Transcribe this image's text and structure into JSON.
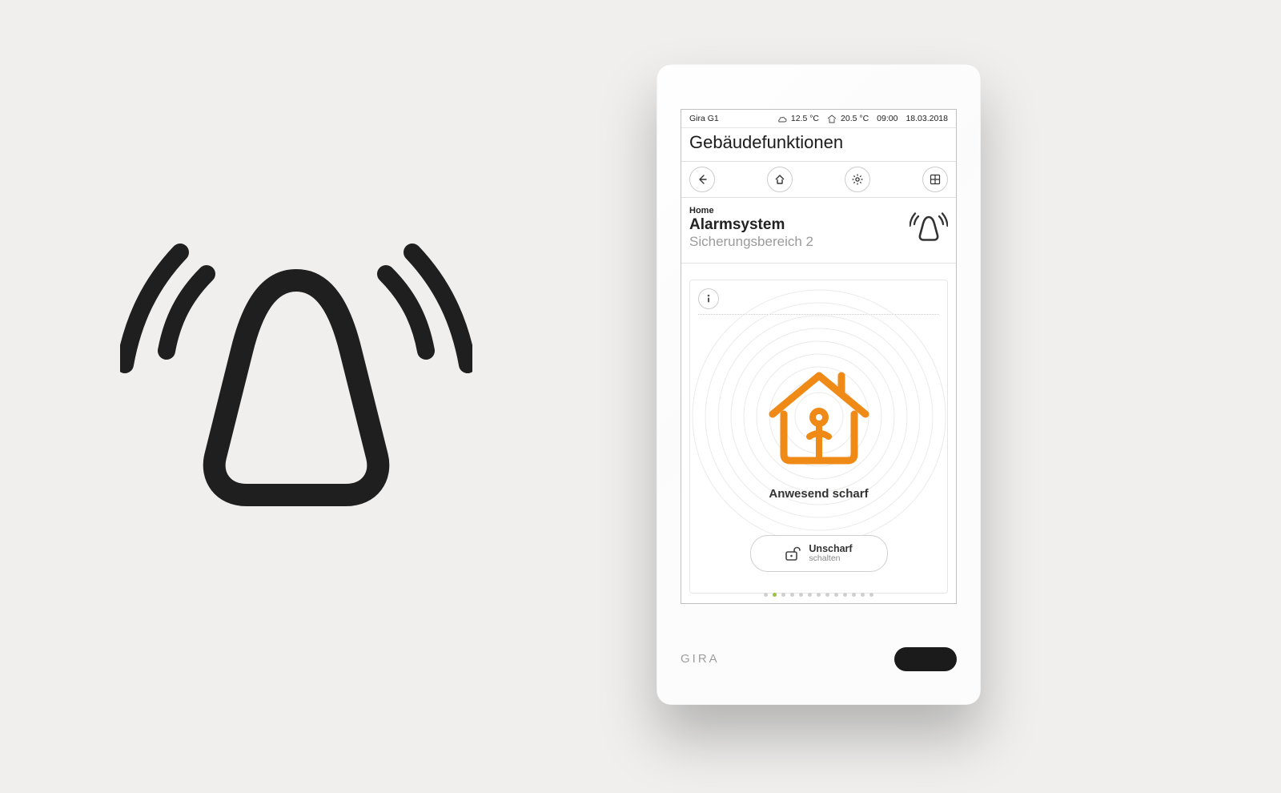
{
  "status": {
    "device_name": "Gira G1",
    "temp_outside": "12.5 °C",
    "temp_inside": "20.5 °C",
    "time": "09:00",
    "date": "18.03.2018"
  },
  "page_title": "Gebäudefunktionen",
  "section": {
    "breadcrumb": "Home",
    "title": "Alarmsystem",
    "subtitle": "Sicherungsbereich 2"
  },
  "card": {
    "state_label": "Anwesend scharf",
    "action_line1": "Unscharf",
    "action_line2": "schalten"
  },
  "pager": {
    "count": 13,
    "active_index": 1
  },
  "brand": "GIRA",
  "colors": {
    "accent": "#f08a16"
  }
}
